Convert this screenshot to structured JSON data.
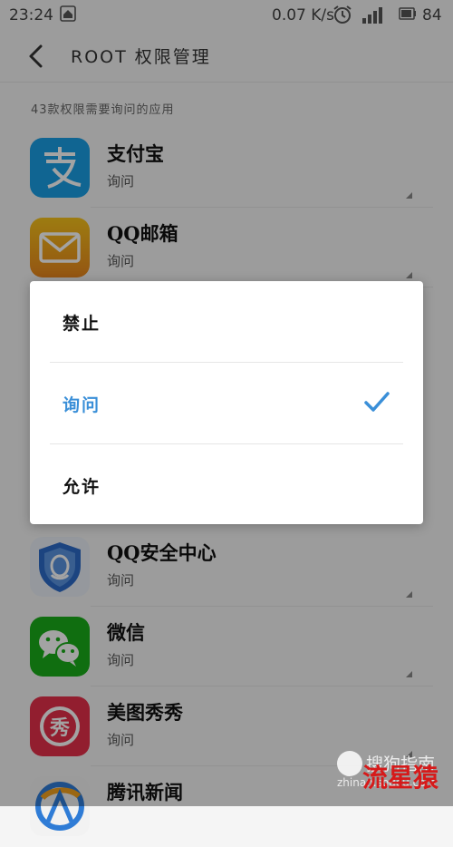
{
  "status_bar": {
    "time": "23:24",
    "net_speed": "0.07 K/s",
    "battery": "84"
  },
  "header": {
    "title": "ROOT 权限管理"
  },
  "section_label": "43款权限需要询问的应用",
  "apps": [
    {
      "name": "支付宝",
      "permission": "询问",
      "icon": "alipay-icon",
      "color": "#1a9ee5"
    },
    {
      "name": "QQ邮箱",
      "permission": "询问",
      "icon": "qq-mail-icon",
      "color": "#f0b41a"
    },
    {
      "name": "QQ安全中心",
      "permission": "询问",
      "icon": "qq-security-icon",
      "color": "#2d6bc8"
    },
    {
      "name": "微信",
      "permission": "询问",
      "icon": "wechat-icon",
      "color": "#1aad19"
    },
    {
      "name": "美图秀秀",
      "permission": "询问",
      "icon": "meitu-icon",
      "color": "#e5304a"
    },
    {
      "name": "腾讯新闻",
      "permission": "",
      "icon": "tencent-news-icon",
      "color": "#2f7cd6"
    }
  ],
  "dialog": {
    "options": [
      {
        "label": "禁止",
        "selected": false
      },
      {
        "label": "询问",
        "selected": true
      },
      {
        "label": "允许",
        "selected": false
      }
    ],
    "accent_color": "#3a8fd8"
  },
  "watermark": {
    "brand": "搜狗指南",
    "url": "zhinan.sogou.com",
    "signature": "流星猿"
  }
}
